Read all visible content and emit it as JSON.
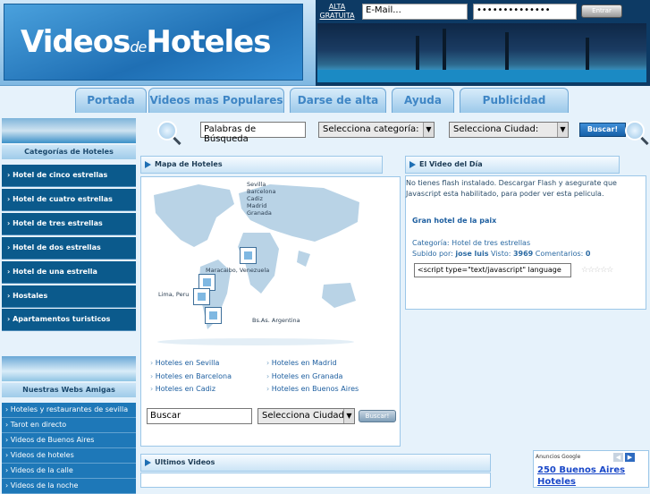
{
  "header": {
    "logo": "Videos de Hoteles",
    "logo_main": "Videos",
    "logo_de": "de",
    "logo_end": "Hoteles",
    "alta": "ALTA GRATUITA",
    "email_value": "E-Mail...",
    "password_value": "••••••••••••••",
    "enter_label": "Entrar"
  },
  "nav": {
    "tabs": [
      "Portada",
      "Videos mas Populares",
      "Darse de alta",
      "Ayuda",
      "Publicidad"
    ]
  },
  "search": {
    "keywords": "Palabras de Búsqueda",
    "category": "Selecciona categoría:",
    "city": "Selecciona Ciudad:",
    "button": "Buscar!"
  },
  "sidebar": {
    "categories_title": "Categorías de Hoteles",
    "categories": [
      "Hotel de cinco estrellas",
      "Hotel de cuatro estrellas",
      "Hotel de tres estrellas",
      "Hotel de dos estrellas",
      "Hotel de una estrella",
      "Hostales",
      "Apartamentos turisticos"
    ],
    "friends_title": "Nuestras Webs Amigas",
    "friends": [
      "Hoteles y restaurantes de sevilla",
      "Tarot en directo",
      "Videos de Buenos Aires",
      "Videos de hoteles",
      "Videos de la calle",
      "Videos de la noche"
    ]
  },
  "map": {
    "title": "Mapa de Hoteles",
    "labels": {
      "spain": "Sevilla\nBarcelona\nCadiz\nMadrid\nGranada",
      "maracaibo": "Maracaibo, Venezuela",
      "lima": "Lima, Peru",
      "bsas": "Bs.As. Argentina"
    },
    "spain_lines": [
      "Sevilla",
      "Barcelona",
      "Cadiz",
      "Madrid",
      "Granada"
    ],
    "links": [
      "Hoteles en Sevilla",
      "Hoteles en Madrid",
      "Hoteles en Barcelona",
      "Hoteles en Granada",
      "Hoteles en Cadiz",
      "Hoteles en Buenos Aires"
    ],
    "search_value": "Buscar",
    "city_select": "Selecciona Ciudad:",
    "button": "Buscar!"
  },
  "video": {
    "title": "El Video del Día",
    "notice": "No tienes flash instalado. Descargar Flash y asegurate que Javascript esta habilitado, para poder ver esta pelicula.",
    "hotel_name": "Gran hotel de la paix",
    "category": "Categoría: Hotel de tres estrellas",
    "uploaded_prefix": "Subido por: ",
    "uploader": "jose luis",
    "views_prefix": " Visto: ",
    "views": "3969",
    "comments_prefix": " Comentarios: ",
    "comments": "0",
    "embed_code": "<script type=\"text/javascript\" language",
    "rating": 0
  },
  "latest": {
    "title": "Ultimos Videos"
  },
  "ads": {
    "label": "Anuncios Google",
    "link1": "250 Buenos Aires",
    "link2": "Hoteles"
  }
}
